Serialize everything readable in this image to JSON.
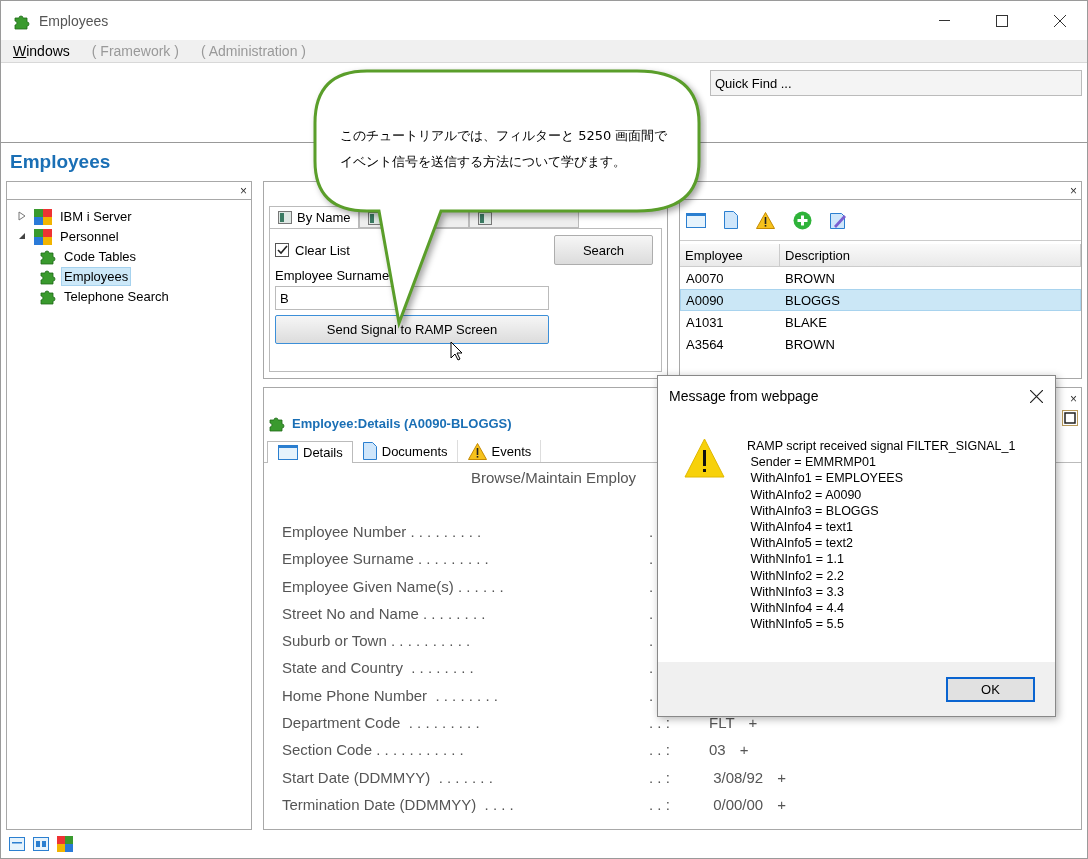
{
  "window": {
    "title": "Employees"
  },
  "menu": [
    {
      "label": "Windows",
      "enabled": true
    },
    {
      "label": "( Framework )",
      "enabled": false
    },
    {
      "label": "( Administration )",
      "enabled": false
    }
  ],
  "quick_find": {
    "placeholder": "Quick Find ..."
  },
  "heading": "Employees",
  "panel_close": {
    "tree": "×",
    "list": "×",
    "details": "×"
  },
  "tree": [
    {
      "label": "IBM i Server",
      "kind": "server",
      "expanded": false,
      "selected": false
    },
    {
      "label": "Personnel",
      "kind": "server",
      "expanded": true,
      "selected": false,
      "children": [
        {
          "label": "Code Tables",
          "kind": "app",
          "selected": false
        },
        {
          "label": "Employees",
          "kind": "app",
          "selected": true
        },
        {
          "label": "Telephone Search",
          "kind": "app",
          "selected": false
        }
      ]
    }
  ],
  "filter": {
    "tabs": [
      {
        "label": "By Name",
        "selected": true
      },
      {
        "selected": false
      },
      {
        "selected": false
      }
    ],
    "clear_list": {
      "label": "Clear List",
      "checked": true
    },
    "search_button": "Search",
    "surname": {
      "label": "Employee Surname",
      "value": "B"
    },
    "send_button": "Send Signal to RAMP Screen"
  },
  "list": {
    "columns": [
      "Employee",
      "Description"
    ],
    "rows": [
      {
        "cells": [
          "A0070",
          "BROWN"
        ],
        "selected": false
      },
      {
        "cells": [
          "A0090",
          "BLOGGS"
        ],
        "selected": true
      },
      {
        "cells": [
          "A1031",
          "BLAKE"
        ],
        "selected": false
      },
      {
        "cells": [
          "A3564",
          "BROWN"
        ],
        "selected": false
      }
    ]
  },
  "details": {
    "title": "Employee:Details (A0090-BLOGGS)",
    "tabs": [
      {
        "label": "Details",
        "kind": "window",
        "selected": true
      },
      {
        "label": "Documents",
        "kind": "document",
        "selected": false
      },
      {
        "label": "Events",
        "kind": "warning",
        "selected": false
      }
    ],
    "screen_heading": "Browse/Maintain Employ",
    "fields": [
      {
        "label": "Employee Number . . . . . . . . .",
        "separator": "."
      },
      {
        "label": "Employee Surname . . . . . . . . .",
        "separator": "."
      },
      {
        "label": "Employee Given Name(s) . . . . . .",
        "separator": "."
      },
      {
        "label": "Street No and Name . . . . . . . .",
        "separator": "."
      },
      {
        "label": "Suburb or Town . . . . . . . . . .",
        "separator": "."
      },
      {
        "label": "State and Country  . . . . . . . .",
        "separator": "."
      },
      {
        "label": "Home Phone Number  . . . . . . . .",
        "separator": "."
      },
      {
        "label": "Department Code  . . . . . . . . .",
        "separator": ". . :",
        "value": "FLT",
        "prompt": "+"
      },
      {
        "label": "Section Code . . . . . . . . . . .",
        "separator": ". . :",
        "value": "03",
        "prompt": "+"
      },
      {
        "label": "Start Date (DDMMYY)  . . . . . . .",
        "separator": ". . :",
        "value": " 3/08/92",
        "prompt": "+"
      },
      {
        "label": "Termination Date (DDMMYY)  . . . .",
        "separator": ". . :",
        "value": " 0/00/00",
        "prompt": "+"
      }
    ]
  },
  "callout": {
    "lines": [
      "このチュートリアルでは、フィルターと 5250 画面間で",
      "イベント信号を送信する方法について学びます。"
    ]
  },
  "dialog": {
    "title": "Message from webpage",
    "lines": [
      "RAMP script received signal FILTER_SIGNAL_1",
      " Sender = EMMRMP01",
      " WithAInfo1 = EMPLOYEES",
      " WithAInfo2 = A0090",
      " WithAInfo3 = BLOGGS",
      " WithAInfo4 = text1",
      " WithAInfo5 = text2",
      " WithNInfo1 = 1.1",
      " WithNInfo2 = 2.2",
      " WithNInfo3 = 3.3",
      " WithNInfo4 = 4.4",
      " WithNInfo5 = 5.5"
    ],
    "button": "OK"
  }
}
